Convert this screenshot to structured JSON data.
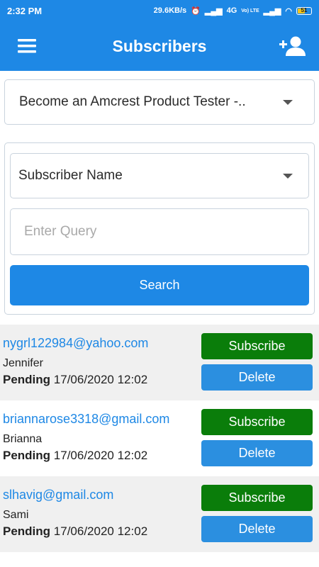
{
  "statusbar": {
    "time": "2:32 PM",
    "speed": "29.6KB/s",
    "network": "4G",
    "volte": "Vo) LTE",
    "battery": "51"
  },
  "appbar": {
    "title": "Subscribers",
    "menu_icon": "hamburger-menu-icon",
    "add_icon": "add-person-icon"
  },
  "campaign_select": {
    "value": "Become an Amcrest Product Tester -..",
    "icon": "chevron-down-icon"
  },
  "filter": {
    "field_select": "Subscriber Name",
    "query_placeholder": "Enter Query",
    "query_value": "",
    "search_label": "Search"
  },
  "subscribers": [
    {
      "email": "nygrl122984@yahoo.com",
      "name": "Jennifer",
      "status": "Pending",
      "date": "17/06/2020 12:02",
      "subscribe_label": "Subscribe",
      "delete_label": "Delete"
    },
    {
      "email": "briannarose3318@gmail.com",
      "name": "Brianna",
      "status": "Pending",
      "date": "17/06/2020 12:02",
      "subscribe_label": "Subscribe",
      "delete_label": "Delete"
    },
    {
      "email": "slhavig@gmail.com",
      "name": "Sami",
      "status": "Pending",
      "date": "17/06/2020 12:02",
      "subscribe_label": "Subscribe",
      "delete_label": "Delete"
    }
  ],
  "colors": {
    "primary": "#1e88e5",
    "subscribe": "#0a7d0a",
    "delete": "#2b8fe0"
  }
}
